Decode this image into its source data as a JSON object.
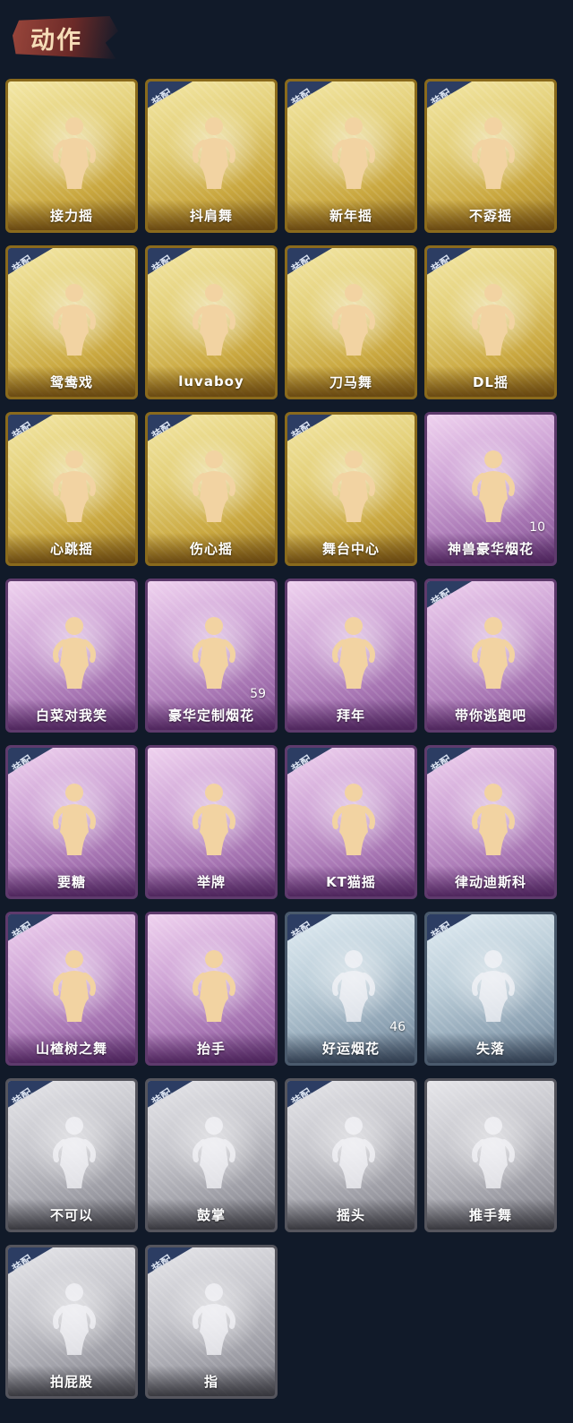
{
  "section": {
    "title": "动作"
  },
  "equip_tag": "装配",
  "colors": {
    "gold": "#e3cf78",
    "purple": "#cfa5d6",
    "blue": "#bcced9",
    "gray": "#c6c6cc",
    "background": "#111a29"
  },
  "cards": [
    {
      "label": "接力摇",
      "tier": "gold",
      "equipped": false,
      "icon": "dancing-figure-icon",
      "count": ""
    },
    {
      "label": "抖肩舞",
      "tier": "gold",
      "equipped": true,
      "icon": "dancing-figure-icon",
      "count": ""
    },
    {
      "label": "新年摇",
      "tier": "gold",
      "equipped": true,
      "icon": "dancing-figure-icon",
      "count": ""
    },
    {
      "label": "不孬摇",
      "tier": "gold",
      "equipped": true,
      "icon": "dancing-figure-icon",
      "count": ""
    },
    {
      "label": "鸳鸯戏",
      "tier": "gold",
      "equipped": true,
      "icon": "dancing-figure-icon",
      "count": ""
    },
    {
      "label": "luvaboy",
      "tier": "gold",
      "equipped": true,
      "icon": "dancing-figure-icon",
      "count": ""
    },
    {
      "label": "刀马舞",
      "tier": "gold",
      "equipped": true,
      "icon": "dancing-figure-icon",
      "count": ""
    },
    {
      "label": "DL摇",
      "tier": "gold",
      "equipped": true,
      "icon": "dancing-figure-icon",
      "count": ""
    },
    {
      "label": "心跳摇",
      "tier": "gold",
      "equipped": true,
      "icon": "dancing-figure-icon",
      "count": ""
    },
    {
      "label": "伤心摇",
      "tier": "gold",
      "equipped": true,
      "icon": "heart-hands-figure-icon",
      "count": ""
    },
    {
      "label": "舞台中心",
      "tier": "gold",
      "equipped": true,
      "icon": "dancing-figure-icon",
      "count": ""
    },
    {
      "label": "神兽豪华烟花",
      "tier": "purple",
      "equipped": false,
      "icon": "fireworks-icon",
      "count": "10"
    },
    {
      "label": "白菜对我笑",
      "tier": "purple",
      "equipped": false,
      "icon": "dancing-figure-icon",
      "count": ""
    },
    {
      "label": "豪华定制烟花",
      "tier": "purple",
      "equipped": false,
      "icon": "fireworks-box-icon",
      "count": "59"
    },
    {
      "label": "拜年",
      "tier": "purple",
      "equipped": false,
      "icon": "bowing-figure-icon",
      "count": ""
    },
    {
      "label": "带你逃跑吧",
      "tier": "purple",
      "equipped": true,
      "icon": "dancing-figure-icon",
      "count": ""
    },
    {
      "label": "要糖",
      "tier": "purple",
      "equipped": true,
      "icon": "reaching-figure-icon",
      "count": ""
    },
    {
      "label": "举牌",
      "tier": "purple",
      "equipped": false,
      "icon": "sign-holding-figure-icon",
      "count": ""
    },
    {
      "label": "KT猫摇",
      "tier": "purple",
      "equipped": true,
      "icon": "dancing-figure-icon",
      "count": ""
    },
    {
      "label": "律动迪斯科",
      "tier": "purple",
      "equipped": true,
      "icon": "disco-figure-icon",
      "count": ""
    },
    {
      "label": "山楂树之舞",
      "tier": "purple",
      "equipped": true,
      "icon": "dancing-figure-icon",
      "count": ""
    },
    {
      "label": "抬手",
      "tier": "purple",
      "equipped": false,
      "icon": "raising-hand-figure-icon",
      "count": ""
    },
    {
      "label": "好运烟花",
      "tier": "blue",
      "equipped": true,
      "icon": "firework-can-icon",
      "count": "46"
    },
    {
      "label": "失落",
      "tier": "blue",
      "equipped": true,
      "icon": "crawling-figure-icon",
      "count": ""
    },
    {
      "label": "不可以",
      "tier": "gray",
      "equipped": true,
      "icon": "finger-wag-icon",
      "count": ""
    },
    {
      "label": "鼓掌",
      "tier": "gray",
      "equipped": true,
      "icon": "clapping-hands-icon",
      "count": ""
    },
    {
      "label": "摇头",
      "tier": "gray",
      "equipped": true,
      "icon": "head-shake-figure-icon",
      "count": ""
    },
    {
      "label": "推手舞",
      "tier": "gray",
      "equipped": false,
      "icon": "pushing-figure-icon",
      "count": ""
    },
    {
      "label": "拍屁股",
      "tier": "gray",
      "equipped": true,
      "icon": "bending-figure-icon",
      "count": ""
    },
    {
      "label": "指",
      "tier": "gray",
      "equipped": true,
      "icon": "pointing-hand-icon",
      "count": ""
    }
  ]
}
